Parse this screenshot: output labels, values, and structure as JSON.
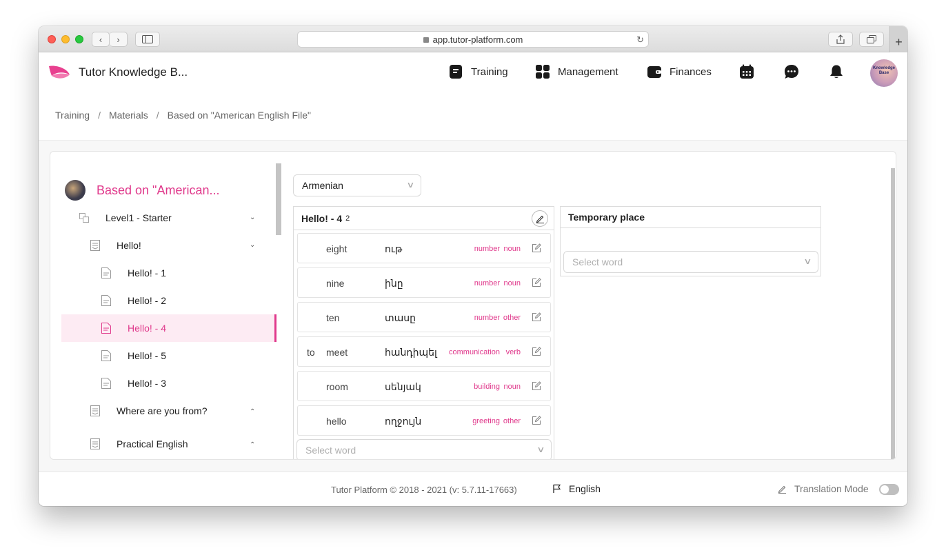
{
  "browser": {
    "url": "app.tutor-platform.com",
    "back": "‹",
    "forward": "›",
    "reload": "↻",
    "new_tab": "+"
  },
  "header": {
    "brand": "Tutor Knowledge B...",
    "nav": [
      {
        "label": "Training",
        "icon": "training-icon"
      },
      {
        "label": "Management",
        "icon": "grid-icon"
      },
      {
        "label": "Finances",
        "icon": "wallet-icon"
      }
    ],
    "icons": [
      "calendar-icon",
      "chat-icon",
      "bell-icon"
    ],
    "avatar_text": "Knowledge Base"
  },
  "breadcrumb": [
    "Training",
    "Materials",
    "Based on \"American English File\""
  ],
  "tree": {
    "course_title": "Based on \"American...",
    "level": "Level1 - Starter",
    "unit": "Hello!",
    "lessons": [
      "Hello! - 1",
      "Hello! - 2",
      "Hello! - 4",
      "Hello! - 5",
      "Hello! - 3"
    ],
    "active_lesson": "Hello! - 4",
    "more_units": [
      "Where are you from?",
      "Practical English"
    ]
  },
  "main": {
    "language": "Armenian",
    "lesson_panel": {
      "title": "Hello! - 4",
      "count": "2",
      "words": [
        {
          "prefix": "",
          "en": "eight",
          "hy": "ութ",
          "category": "number",
          "pos": "noun"
        },
        {
          "prefix": "",
          "en": "nine",
          "hy": "ինը",
          "category": "number",
          "pos": "noun"
        },
        {
          "prefix": "",
          "en": "ten",
          "hy": "տասը",
          "category": "number",
          "pos": "other"
        },
        {
          "prefix": "to",
          "en": "meet",
          "hy": "հանդիպել",
          "category": "communication",
          "pos": "verb"
        },
        {
          "prefix": "",
          "en": "room",
          "hy": "սենյակ",
          "category": "building",
          "pos": "noun"
        },
        {
          "prefix": "",
          "en": "hello",
          "hy": "ողջույն",
          "category": "greeting",
          "pos": "other"
        }
      ],
      "select_placeholder": "Select word"
    },
    "temp_panel": {
      "title": "Temporary place",
      "select_placeholder": "Select word"
    }
  },
  "footer": {
    "copyright": "Tutor Platform © 2018 - 2021 (v: 5.7.11-17663)",
    "language": "English",
    "translation_mode": "Translation Mode",
    "translation_mode_on": false
  },
  "colors": {
    "accent": "#e0388b",
    "active_bg": "#fdebf3"
  }
}
